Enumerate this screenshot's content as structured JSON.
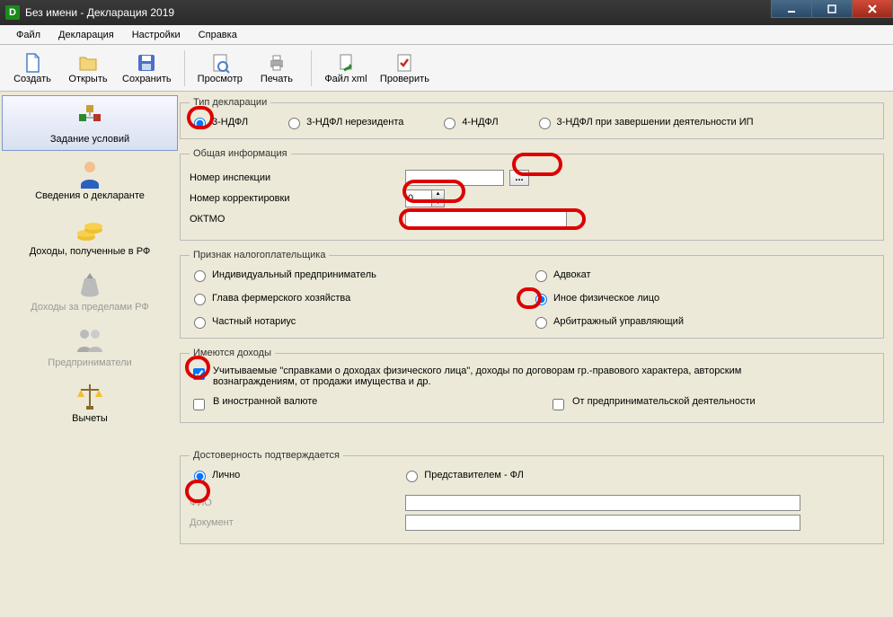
{
  "window": {
    "title": "Без имени - Декларация 2019",
    "app_initial": "D"
  },
  "menu": {
    "file": "Файл",
    "declaration": "Декларация",
    "settings": "Настройки",
    "help": "Справка"
  },
  "toolbar": {
    "create": "Создать",
    "open": "Открыть",
    "save": "Сохранить",
    "preview": "Просмотр",
    "print": "Печать",
    "filexml": "Файл xml",
    "check": "Проверить"
  },
  "sidebar": {
    "conditions": "Задание условий",
    "declarant": "Сведения о декларанте",
    "income_rf": "Доходы, полученные в РФ",
    "income_abroad": "Доходы за пределами РФ",
    "entrepreneurs": "Предприниматели",
    "deductions": "Вычеты"
  },
  "form": {
    "decl_type": {
      "legend": "Тип декларации",
      "r1": "3-НДФЛ",
      "r2": "3-НДФЛ нерезидента",
      "r3": "4-НДФЛ",
      "r4": "3-НДФЛ при завершении деятельности ИП"
    },
    "general": {
      "legend": "Общая информация",
      "inspection": "Номер инспекции",
      "correction": "Номер корректировки",
      "correction_val": "0",
      "oktmo": "ОКТМО",
      "ellipsis": "..."
    },
    "taxpayer": {
      "legend": "Признак налогоплательщика",
      "ip": "Индивидуальный предприниматель",
      "advokat": "Адвокат",
      "farmer": "Глава фермерского хозяйства",
      "other_person": "Иное физическое лицо",
      "notary": "Частный нотариус",
      "arbitr": "Арбитражный управляющий"
    },
    "income": {
      "legend": "Имеются доходы",
      "c1": "Учитываемые \"справками о доходах физического лица\", доходы по договорам гр.-правового характера, авторским вознаграждениям, от продажи имущества и др.",
      "c2": "В иностранной валюте",
      "c3": "От предпринимательской деятельности"
    },
    "trust": {
      "legend": "Достоверность подтверждается",
      "personally": "Лично",
      "representative": "Представителем - ФЛ",
      "fio": "ФИО",
      "document": "Документ"
    }
  }
}
